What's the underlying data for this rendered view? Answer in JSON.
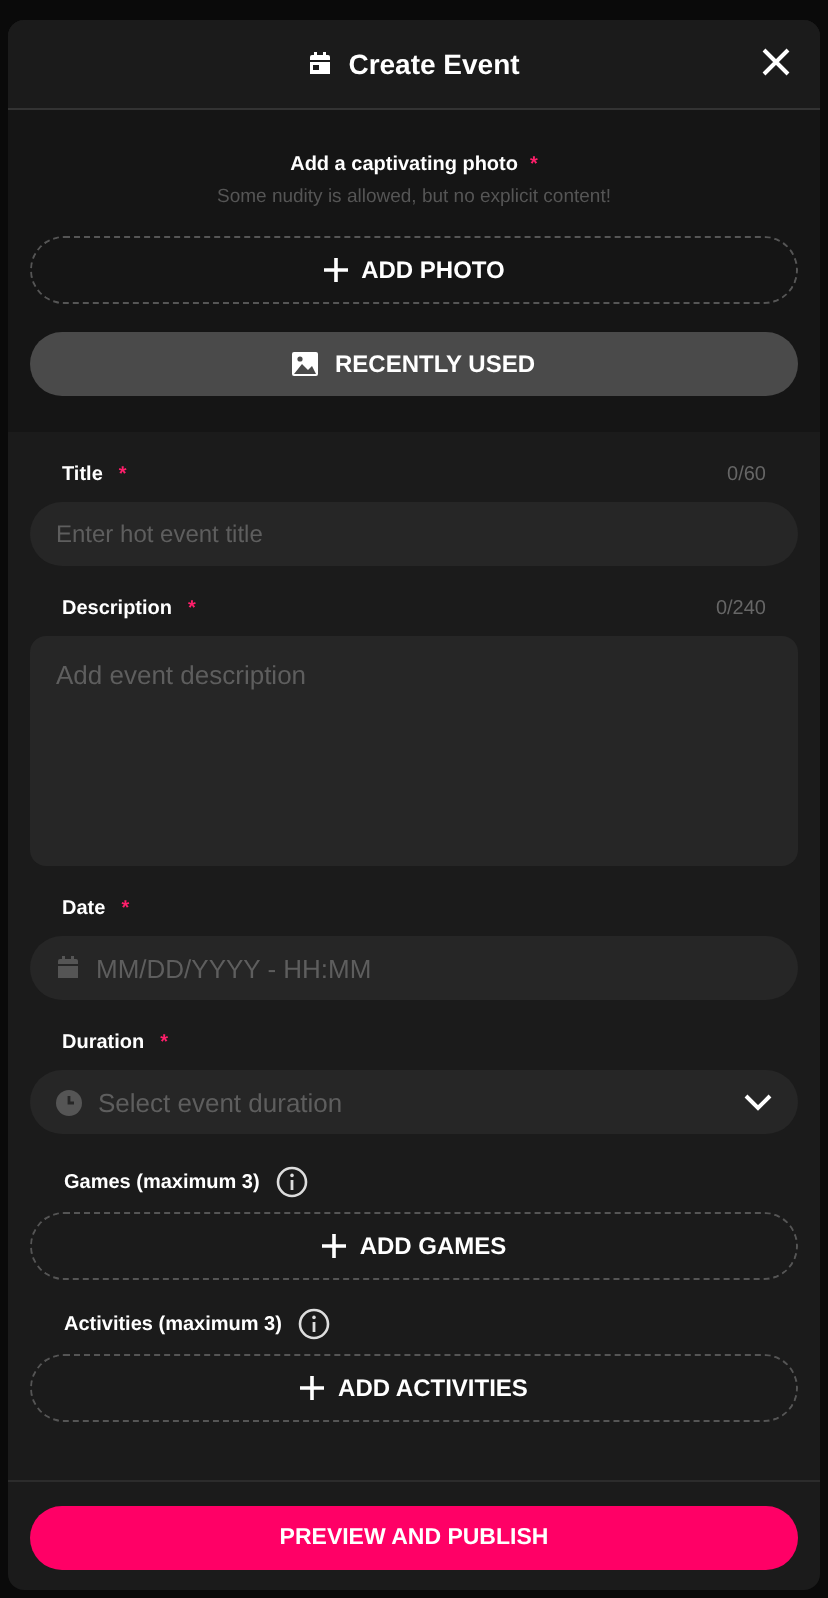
{
  "dialog": {
    "title": "Create Event"
  },
  "photo": {
    "label": "Add a captivating photo",
    "required_mark": "*",
    "hint": "Some nudity is allowed, but no explicit content!",
    "add_button": "ADD PHOTO",
    "recent_button": "RECENTLY USED"
  },
  "fields": [
    {
      "kind": "text",
      "label": "Title",
      "required_mark": "*",
      "counter": "0/60",
      "placeholder": "Enter hot event title"
    },
    {
      "kind": "textarea",
      "label": "Description",
      "required_mark": "*",
      "counter": "0/240",
      "placeholder": "Add event description"
    },
    {
      "kind": "date",
      "label": "Date",
      "required_mark": "*",
      "placeholder": "MM/DD/YYYY - HH:MM"
    },
    {
      "kind": "select",
      "label": "Duration",
      "required_mark": "*",
      "placeholder": "Select event duration"
    }
  ],
  "pickers": [
    {
      "label": "Games (maximum 3)",
      "button": "ADD GAMES"
    },
    {
      "label": "Activities (maximum 3)",
      "button": "ADD ACTIVITIES"
    }
  ],
  "publish_button": "PREVIEW AND PUBLISH"
}
